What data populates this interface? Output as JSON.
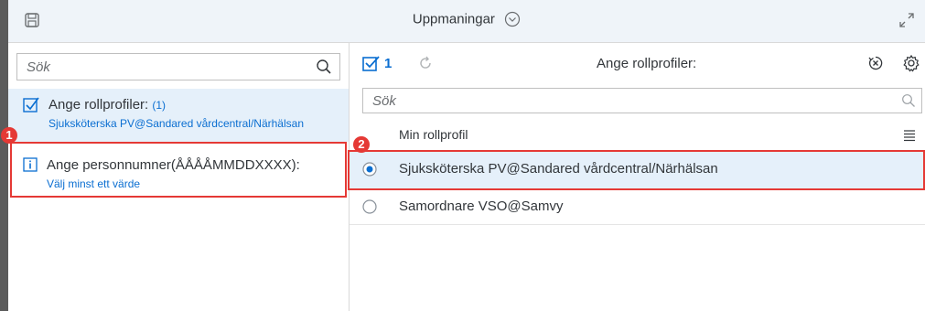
{
  "header": {
    "title": "Uppmaningar",
    "icons": [
      "save-icon",
      "chevron-down-circle-icon",
      "expand-icon"
    ]
  },
  "left": {
    "search_placeholder": "Sök",
    "items": [
      {
        "title": "Ange rollprofiler:",
        "count": "(1)",
        "subtitle": "Sjuksköterska PV@Sandared vårdcentral/Närhälsan",
        "icon": "checkbox-checked-icon"
      },
      {
        "title": "Ange personnumner(ÅÅÅÅMMDDXXXX):",
        "subtitle": "Välj minst ett värde",
        "icon": "info-icon"
      }
    ]
  },
  "right": {
    "selected_count": "1",
    "title": "Ange rollprofiler:",
    "search_placeholder": "Sök",
    "column_header": "Min rollprofil",
    "options": [
      {
        "label": "Sjuksköterska PV@Sandared vårdcentral/Närhälsan",
        "selected": true
      },
      {
        "label": "Samordnare VSO@Samvy",
        "selected": false
      }
    ]
  },
  "annotations": {
    "badge1": "1",
    "badge2": "2"
  },
  "colors": {
    "accent": "#0a6ed1",
    "highlight": "#e53935",
    "selected_bg": "#e5f0fa",
    "header_bg": "#eff4f9"
  }
}
